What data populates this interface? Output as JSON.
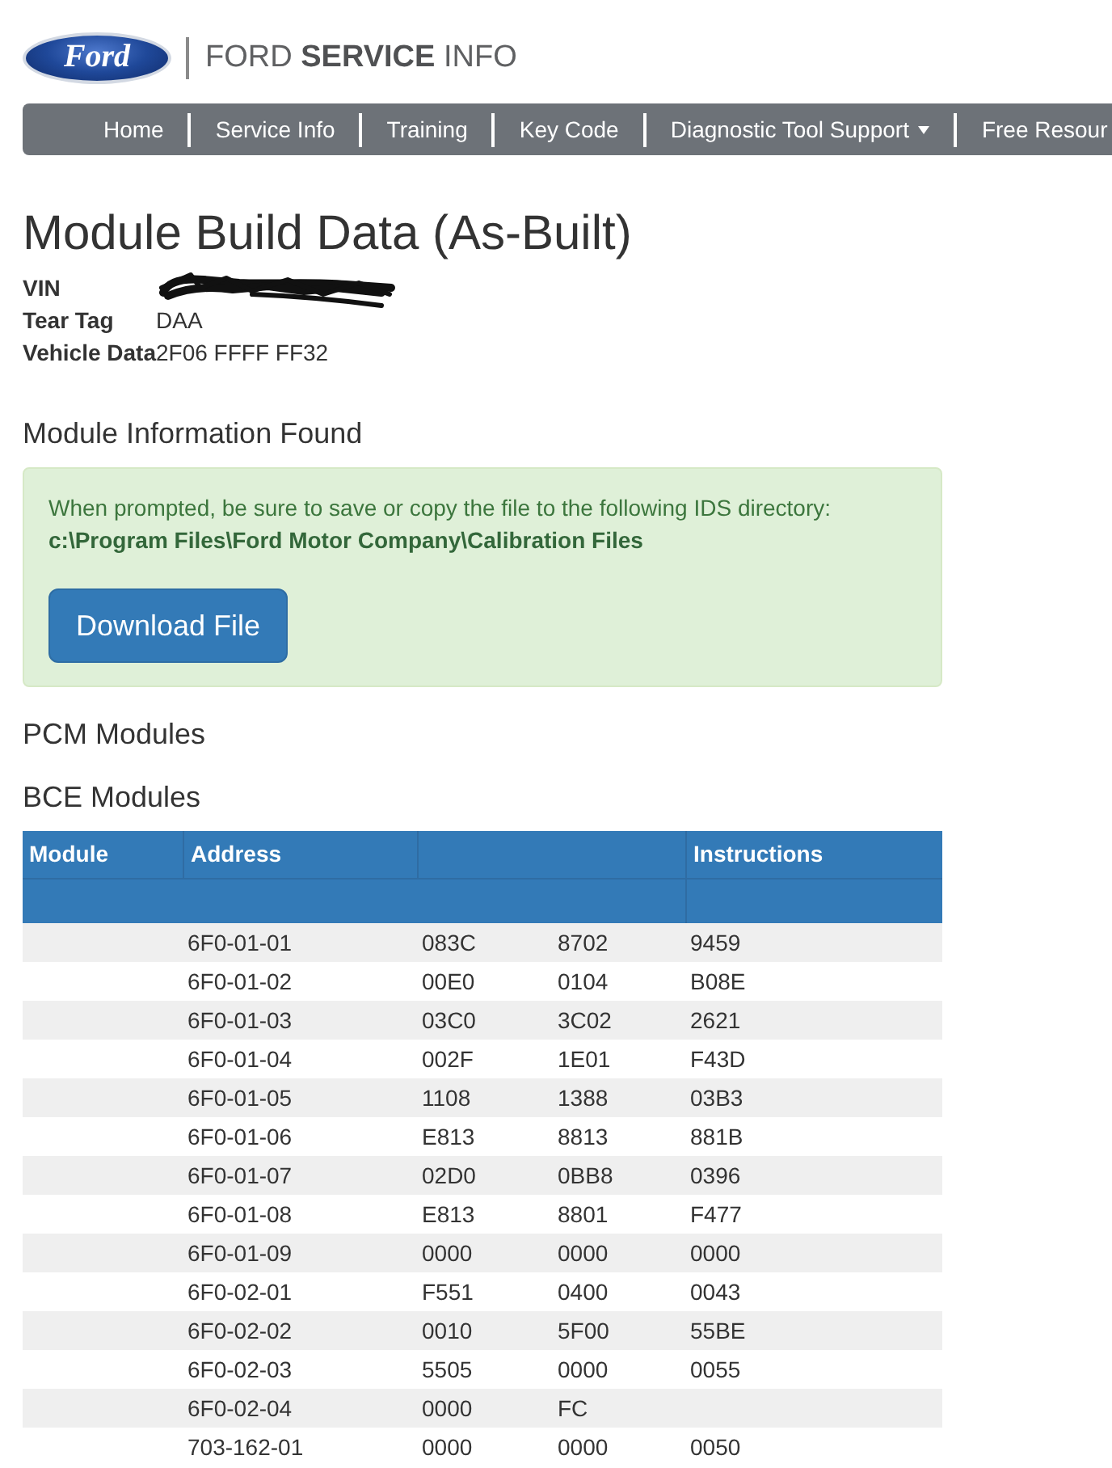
{
  "header": {
    "logo": "Ford",
    "site_title": "FORD **SERVICE** INFO"
  },
  "nav": {
    "items": [
      {
        "label": "Home",
        "dropdown": false
      },
      {
        "label": "Service Info",
        "dropdown": false
      },
      {
        "label": "Training",
        "dropdown": false
      },
      {
        "label": "Key Code",
        "dropdown": false
      },
      {
        "label": "Diagnostic Tool Support",
        "dropdown": true
      },
      {
        "label": "Free Resour",
        "dropdown": false
      }
    ]
  },
  "page_title": "Module Build Data (As-Built)",
  "vehicle_info": [
    {
      "label": "VIN",
      "redacted": true
    },
    {
      "label": "Tear Tag",
      "value": "DAA",
      "redacted": false
    },
    {
      "label": "Vehicle Data",
      "value": "2F06 FFFF FF32",
      "redacted": false
    }
  ],
  "module_info": {
    "heading": "Module Information Found",
    "message": "When prompted, be sure to save or copy the file to the following IDS directory:",
    "directory": "c:\\Program Files\\Ford Motor Company\\Calibration Files",
    "button": "Download File"
  },
  "module_groups": [
    {
      "heading": "PCM Modules"
    },
    {
      "heading": "BCE Modules",
      "table": {
        "columns": [
          "Module",
          "Address",
          "Instructions"
        ],
        "rows": [
          {
            "address": "6F0-01-01",
            "values": [
              "083C",
              "8702",
              "9459"
            ]
          },
          {
            "address": "6F0-01-02",
            "values": [
              "00E0",
              "0104",
              "B08E"
            ]
          },
          {
            "address": "6F0-01-03",
            "values": [
              "03C0",
              "3C02",
              "2621"
            ]
          },
          {
            "address": "6F0-01-04",
            "values": [
              "002F",
              "1E01",
              "F43D"
            ]
          },
          {
            "address": "6F0-01-05",
            "values": [
              "1108",
              "1388",
              "03B3"
            ]
          },
          {
            "address": "6F0-01-06",
            "values": [
              "E813",
              "8813",
              "881B"
            ]
          },
          {
            "address": "6F0-01-07",
            "values": [
              "02D0",
              "0BB8",
              "0396"
            ]
          },
          {
            "address": "6F0-01-08",
            "values": [
              "E813",
              "8801",
              "F477"
            ]
          },
          {
            "address": "6F0-01-09",
            "values": [
              "0000",
              "0000",
              "0000"
            ]
          },
          {
            "address": "6F0-02-01",
            "values": [
              "F551",
              "0400",
              "0043"
            ]
          },
          {
            "address": "6F0-02-02",
            "values": [
              "0010",
              "5F00",
              "55BE"
            ]
          },
          {
            "address": "6F0-02-03",
            "values": [
              "5505",
              "0000",
              "0055"
            ]
          },
          {
            "address": "6F0-02-04",
            "values": [
              "0000",
              "FC"
            ]
          },
          {
            "address": "703-162-01",
            "values": [
              "0000",
              "0000",
              "0050"
            ]
          }
        ]
      }
    }
  ]
}
